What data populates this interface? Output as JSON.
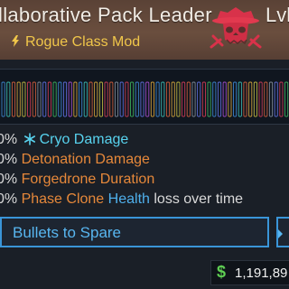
{
  "item": {
    "name": "llaborative Pack Leader",
    "level_label": "Lvl",
    "type_label": "Rogue Class Mod",
    "manufacturer_icon": "skull-cowboy-hat-icon"
  },
  "stats": [
    {
      "prefix": "0%",
      "highlight": "Cryo Damage",
      "rest": "",
      "icon": "snowflake-icon"
    },
    {
      "prefix": "0%",
      "highlight": "Detonation Damage",
      "rest": ""
    },
    {
      "prefix": "0%",
      "highlight": "Forgedrone Duration",
      "rest": ""
    },
    {
      "prefix": "0%",
      "highlight": "Phase Clone",
      "highlight2": "Health",
      "rest": "loss over time"
    }
  ],
  "perk": {
    "name": "Bullets to Spare"
  },
  "price": {
    "value": "1,191,89"
  },
  "colors": {
    "cryo": "#58d3ef",
    "orange": "#e6883a",
    "blue": "#4fb0ec",
    "gold": "#f0c64a",
    "money": "#5fcf53"
  }
}
